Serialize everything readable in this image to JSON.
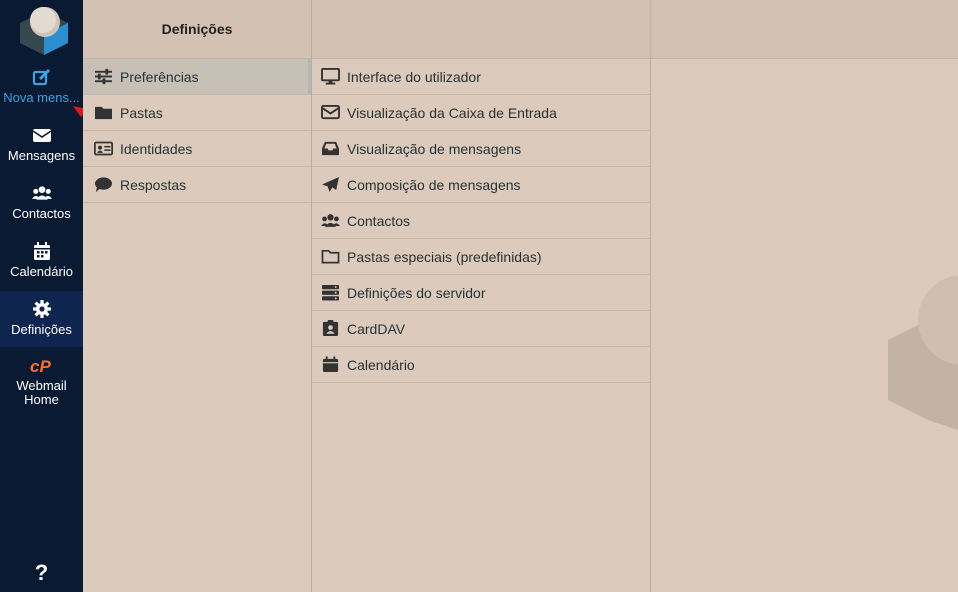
{
  "nav": {
    "items": [
      {
        "label": "Nova mens...",
        "icon": "compose-icon"
      },
      {
        "label": "Mensagens",
        "icon": "envelope-icon"
      },
      {
        "label": "Contactos",
        "icon": "users-icon"
      },
      {
        "label": "Calendário",
        "icon": "calendar-icon"
      },
      {
        "label": "Definições",
        "icon": "gear-icon"
      },
      {
        "label": "Webmail Home",
        "icon": "cpanel-icon"
      }
    ],
    "help": "?"
  },
  "settings_panel": {
    "title": "Definições",
    "items": [
      {
        "label": "Preferências",
        "icon": "sliders-icon",
        "selected": true
      },
      {
        "label": "Pastas",
        "icon": "folder-icon"
      },
      {
        "label": "Identidades",
        "icon": "id-card-icon"
      },
      {
        "label": "Respostas",
        "icon": "comment-icon"
      }
    ]
  },
  "preferences_panel": {
    "items": [
      {
        "label": "Interface do utilizador",
        "icon": "monitor-icon"
      },
      {
        "label": "Visualização da Caixa de Entrada",
        "icon": "envelope-outline-icon"
      },
      {
        "label": "Visualização de mensagens",
        "icon": "inbox-icon"
      },
      {
        "label": "Composição de mensagens",
        "icon": "paper-plane-icon"
      },
      {
        "label": "Contactos",
        "icon": "users-icon"
      },
      {
        "label": "Pastas especiais (predefinidas)",
        "icon": "folder-outline-icon"
      },
      {
        "label": "Definições do servidor",
        "icon": "server-icon"
      },
      {
        "label": "CardDAV",
        "icon": "contact-card-icon"
      },
      {
        "label": "Calendário",
        "icon": "calendar-icon"
      }
    ]
  },
  "colors": {
    "nav_bg": "#0b1a33",
    "accent": "#3aa3e3",
    "panel_bg": "#dccbbc",
    "annotation_arrow": "#e8141c"
  }
}
